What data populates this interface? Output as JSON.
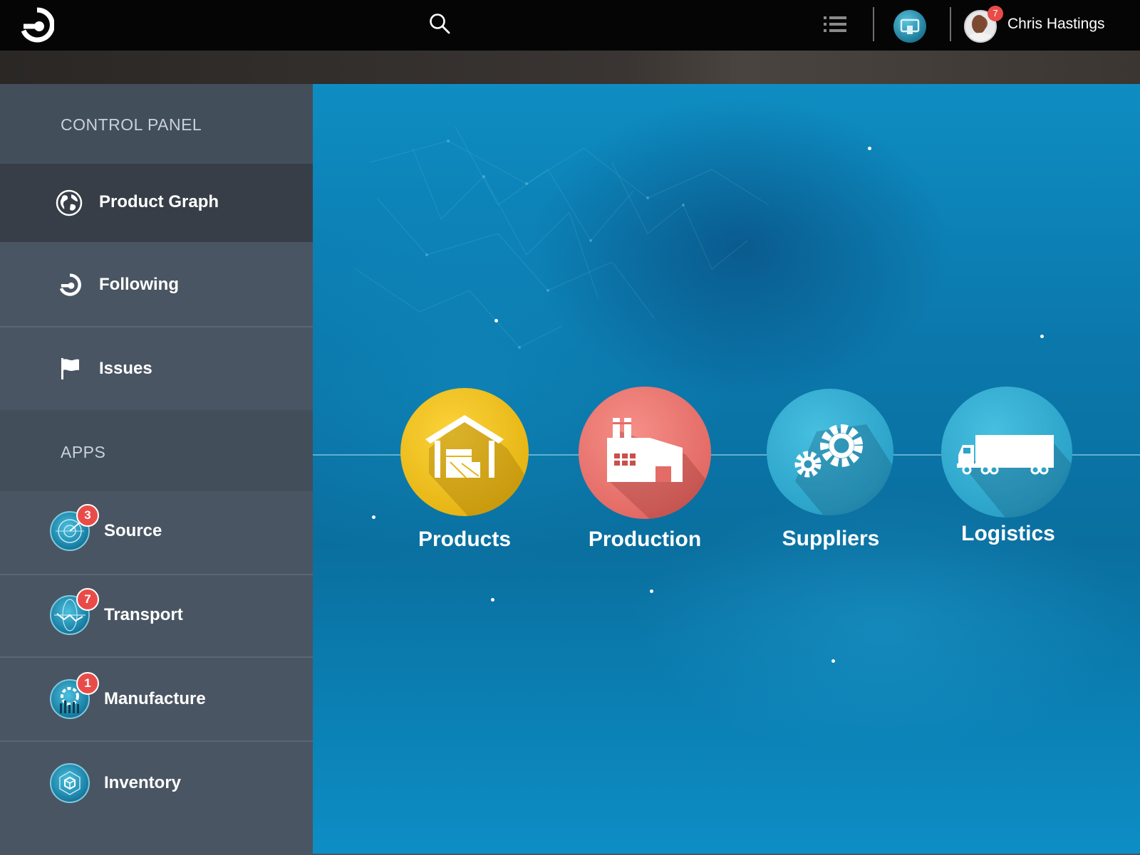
{
  "header": {
    "user_name": "Chris Hastings",
    "notification_count": "7",
    "icons": [
      "logo-icon",
      "search-icon",
      "list-icon",
      "app-badge-icon",
      "avatar"
    ]
  },
  "sidebar": {
    "control_panel_heading": "CONTROL PANEL",
    "nav_items": [
      {
        "label": "Product Graph",
        "icon": "globe-icon",
        "active": true
      },
      {
        "label": "Following",
        "icon": "following-icon"
      },
      {
        "label": "Issues",
        "icon": "flag-icon"
      }
    ],
    "apps_heading": "APPS",
    "apps": [
      {
        "label": "Source",
        "badge": "3",
        "icon": "radar-icon"
      },
      {
        "label": "Transport",
        "badge": "7",
        "icon": "route-globe-icon"
      },
      {
        "label": "Manufacture",
        "badge": "1",
        "icon": "gear-chart-icon"
      },
      {
        "label": "Inventory",
        "icon": "box-icon"
      }
    ]
  },
  "main": {
    "categories": [
      {
        "label": "Products",
        "icon": "warehouse-icon",
        "color": "#f2c21a"
      },
      {
        "label": "Production",
        "icon": "factory-icon",
        "color": "#e9706c"
      },
      {
        "label": "Suppliers",
        "icon": "gears-icon",
        "color": "#2fa8cc"
      },
      {
        "label": "Logistics",
        "icon": "truck-icon",
        "color": "#2fa8cc"
      }
    ]
  },
  "colors": {
    "topbar": "#050505",
    "sidebar": "#4a5563",
    "sidebar_active": "#373e48",
    "main_blue": "#0b77ab",
    "badge_red": "#e94c48"
  }
}
